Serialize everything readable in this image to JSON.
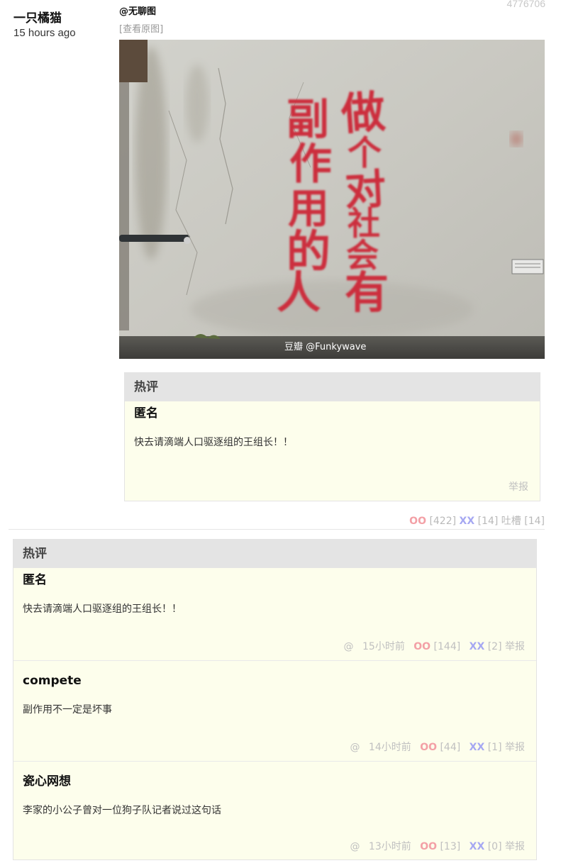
{
  "post": {
    "id": "4776706",
    "author": "一只橘猫",
    "time": "15 hours ago",
    "mention": "@无聊图",
    "view_original": "[查看原图]",
    "image": {
      "wall_text_left": "副作用的人",
      "wall_text_right": "做个对社会有",
      "watermark": "豆瓣 @Funkywave"
    },
    "votes": {
      "oo_label": "OO",
      "oo_count": "[422]",
      "xx_label": "XX",
      "xx_count": "[14]",
      "tucao_label": "吐槽",
      "tucao_count": "[14]"
    }
  },
  "inline_hot": {
    "header": "热评",
    "comment": {
      "author": "匿名",
      "text": "快去请滴端人口驱逐组的王组长！！",
      "report": "举报"
    }
  },
  "hot_comments": {
    "header": "热评",
    "items": [
      {
        "author": "匿名",
        "text": "快去请滴端人口驱逐组的王组长！！",
        "at": "@",
        "time": "15小时前",
        "oo_label": "OO",
        "oo": "[144]",
        "xx_label": "XX",
        "xx": "[2]",
        "report": "举报"
      },
      {
        "author": "compete",
        "text": "副作用不一定是坏事",
        "at": "@",
        "time": "14小时前",
        "oo_label": "OO",
        "oo": "[44]",
        "xx_label": "XX",
        "xx": "[1]",
        "report": "举报"
      },
      {
        "author": "瓷心网想",
        "text": "李家的小公子曾对一位狗子队记者说过这句话",
        "at": "@",
        "time": "13小时前",
        "oo_label": "OO",
        "oo": "[13]",
        "xx_label": "XX",
        "xx": "[0]",
        "report": "举报"
      }
    ]
  },
  "colors": {
    "oo": "#f3a0a6",
    "xx": "#a6a8f2",
    "hot_bg": "#fdfeec",
    "hot_header_bg": "#e4e4e4",
    "graffiti": "#cc2f3c"
  }
}
